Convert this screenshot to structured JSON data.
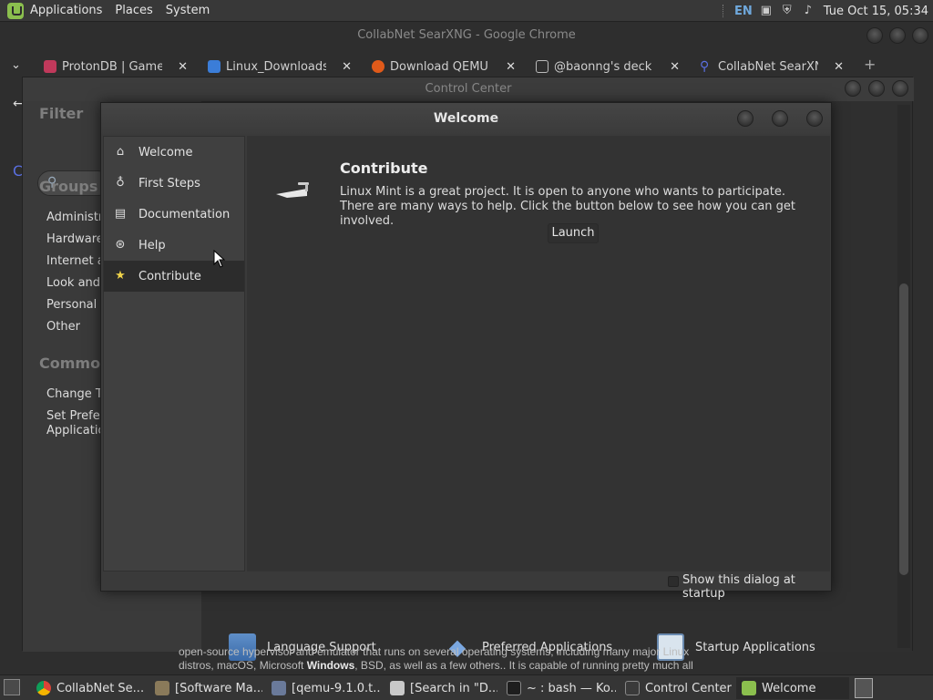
{
  "top_panel": {
    "menus": [
      "Applications",
      "Places",
      "System"
    ],
    "lang": "EN",
    "clock": "Tue Oct 15, 05:34"
  },
  "chrome": {
    "title": "CollabNet SearXNG - Google Chrome",
    "tabs": [
      {
        "label": "ProtonDB | Game I",
        "color": "#c0395b"
      },
      {
        "label": "Linux_Downloads",
        "color": "#3b7dd8"
      },
      {
        "label": "Download QEMU -",
        "color": "#e05a1a"
      },
      {
        "label": "@baonng's deck o",
        "color": "#bbbbbb"
      },
      {
        "label": "CollabNet SearXNG",
        "color": "#5a6fe0"
      }
    ],
    "page_text_line1": "open-source hypervisor and emulator that runs on several operating systems, including many major Linux",
    "page_text_line2_pre": "distros, macOS, Microsoft ",
    "page_text_line2_bold": "Windows",
    "page_text_line2_post": ", BSD, as well as a few others.. It is capable of running pretty much all"
  },
  "control_center": {
    "title": "Control Center",
    "filter_heading": "Filter",
    "groups_heading": "Groups",
    "groups": [
      "Administr",
      "Hardware",
      "Internet a",
      "Look and",
      "Personal",
      "Other"
    ],
    "common_heading": "Common",
    "common_items": [
      "Change Th",
      "Set Prefer",
      "Applicatio"
    ],
    "apps": [
      "Language Support",
      "Preferred Applications",
      "Startup Applications"
    ]
  },
  "welcome": {
    "title": "Welcome",
    "sidebar": [
      "Welcome",
      "First Steps",
      "Documentation",
      "Help",
      "Contribute"
    ],
    "active_item": "Contribute",
    "content": {
      "heading": "Contribute",
      "description": "Linux Mint is a great project. It is open to anyone who wants to participate. There are many ways to help. Click the button below to see how you can get involved.",
      "button": "Launch"
    },
    "footer_checkbox": "Show this dialog at startup"
  },
  "taskbar": [
    {
      "label": "CollabNet Se..."
    },
    {
      "label": "[Software Ma..."
    },
    {
      "label": "[qemu-9.1.0.t..."
    },
    {
      "label": "[Search in \"D..."
    },
    {
      "label": "~ : bash — Ko..."
    },
    {
      "label": "Control Center"
    },
    {
      "label": "Welcome"
    }
  ]
}
